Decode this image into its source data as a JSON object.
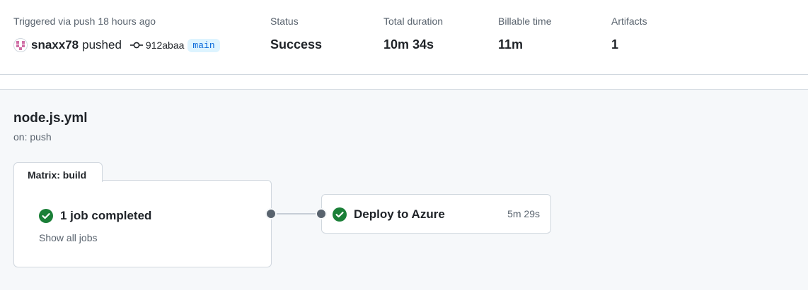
{
  "summary": {
    "trigger_text": "Triggered via push 18 hours ago",
    "actor": "snaxx78",
    "action": "pushed",
    "commit_sha": "912abaa",
    "branch": "main",
    "status_label": "Status",
    "status_value": "Success",
    "duration_label": "Total duration",
    "duration_value": "10m 34s",
    "billable_label": "Billable time",
    "billable_value": "11m",
    "artifacts_label": "Artifacts",
    "artifacts_value": "1"
  },
  "workflow": {
    "file_name": "node.js.yml",
    "trigger": "on: push",
    "matrix": {
      "tab_label": "Matrix: build",
      "status_text": "1 job completed",
      "show_all": "Show all jobs",
      "status_icon": "check-circle-icon"
    },
    "jobs": [
      {
        "name": "Deploy to Azure",
        "duration": "5m 29s",
        "status_icon": "check-circle-icon"
      }
    ]
  },
  "colors": {
    "success": "#1a7f37",
    "branch_bg": "#ddf4ff",
    "branch_text": "#0969da",
    "muted_text": "#59636e",
    "border": "#d0d7de",
    "canvas": "#f6f8fa"
  }
}
